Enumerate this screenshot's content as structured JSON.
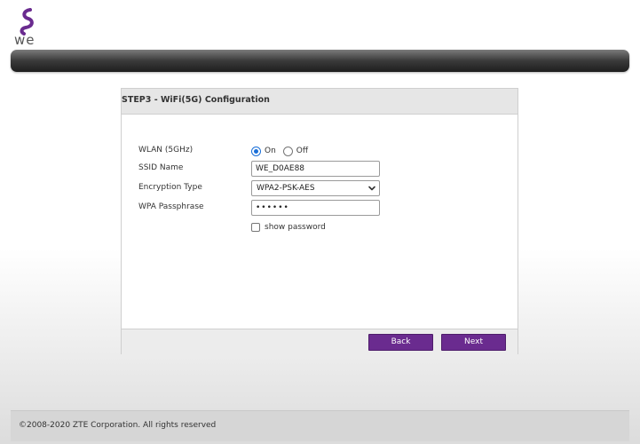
{
  "brand": {
    "logo_text": "we",
    "accent_color": "#6a2b8f"
  },
  "panel": {
    "title": "STEP3 - WiFi(5G) Configuration"
  },
  "form": {
    "wlan": {
      "label": "WLAN (5GHz)",
      "on_label": "On",
      "off_label": "Off",
      "selected": "On"
    },
    "ssid": {
      "label": "SSID Name",
      "value": "WE_D0AE88"
    },
    "encryption": {
      "label": "Encryption Type",
      "value": "WPA2-PSK-AES"
    },
    "passphrase": {
      "label": "WPA Passphrase",
      "value": "••••••"
    },
    "show_password": {
      "label": "show password",
      "checked": false
    }
  },
  "buttons": {
    "back_label": "Back",
    "next_label": "Next"
  },
  "footer": {
    "copyright": "©2008-2020 ZTE Corporation. All rights reserved"
  }
}
